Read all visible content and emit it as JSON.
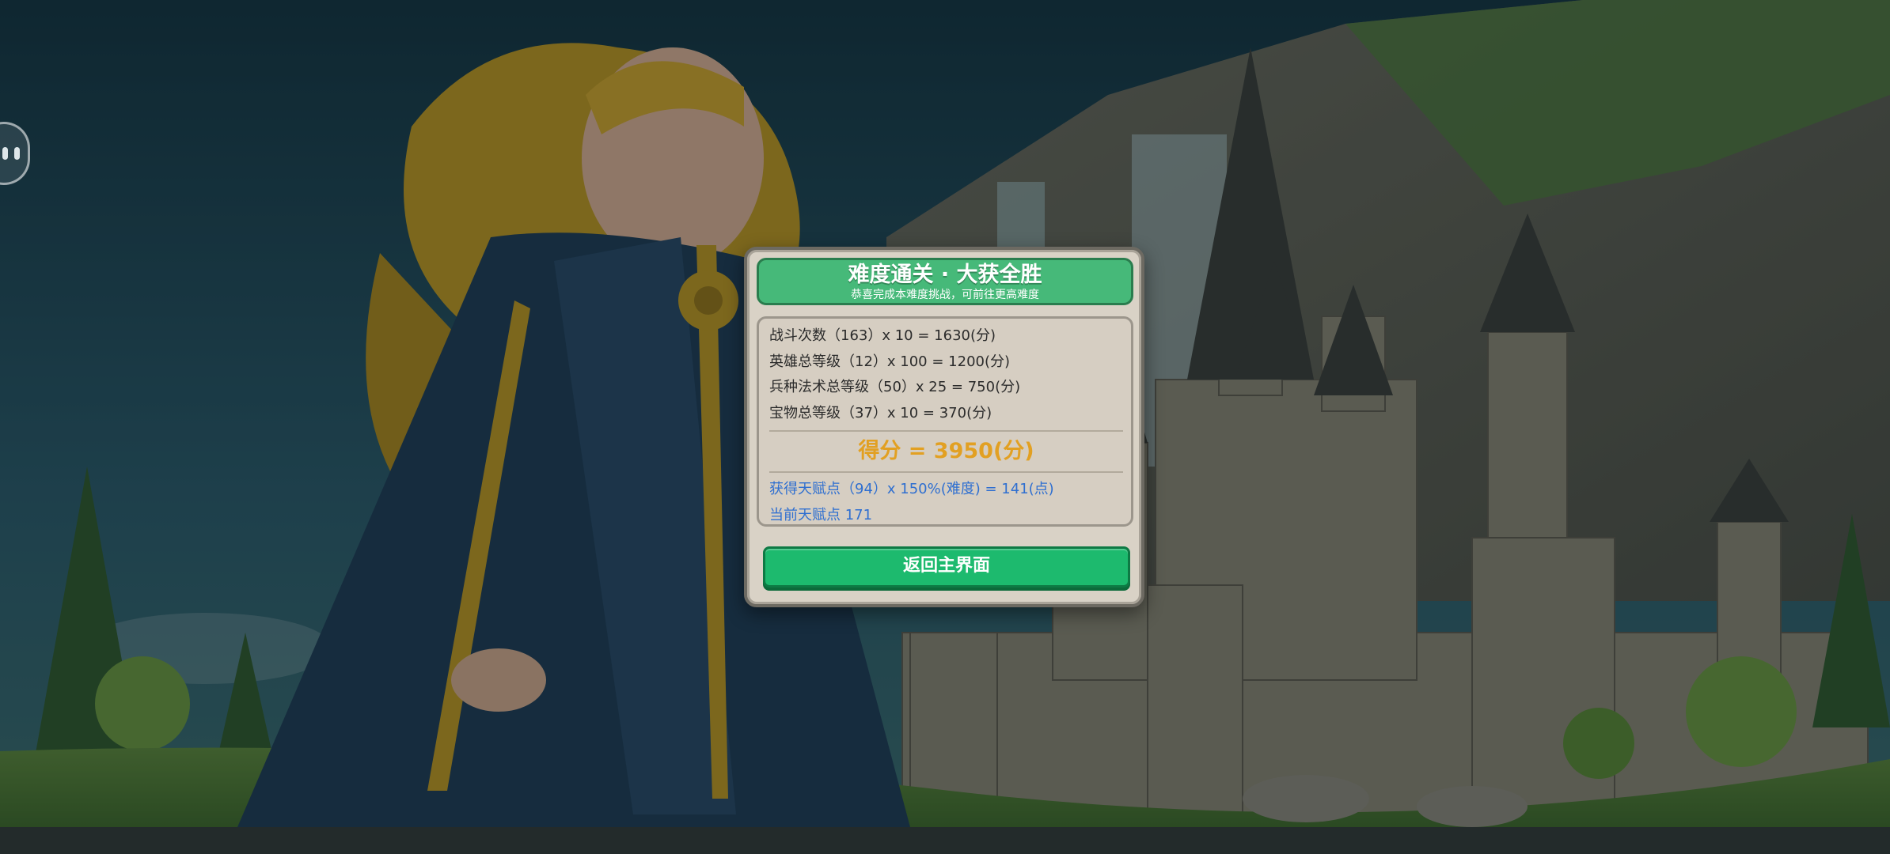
{
  "dialog": {
    "title": "难度通关 · 大获全胜",
    "subtitle": "恭喜完成本难度挑战，可前往更高难度",
    "stats": [
      {
        "text": "战斗次数（163）x 10 = 1630(分)"
      },
      {
        "text": "英雄总等级（12）x 100 = 1200(分)"
      },
      {
        "text": "兵种法术总等级（50）x 25 = 750(分)"
      },
      {
        "text": "宝物总等级（37）x 10 = 370(分)"
      }
    ],
    "score": "得分 = 3950(分)",
    "talent_gain": "获得天赋点（94）x 150%(难度) = 141(点)",
    "talent_current": "当前天赋点 171",
    "return_label": "返回主界面"
  },
  "colors": {
    "banner_green": "#46b979",
    "button_green": "#1dba6e",
    "score_orange": "#e2a022",
    "talent_blue": "#2f6fd0",
    "panel_beige": "#d9d2c6"
  },
  "icons": {
    "side_button": "chat-bubble-icon"
  }
}
